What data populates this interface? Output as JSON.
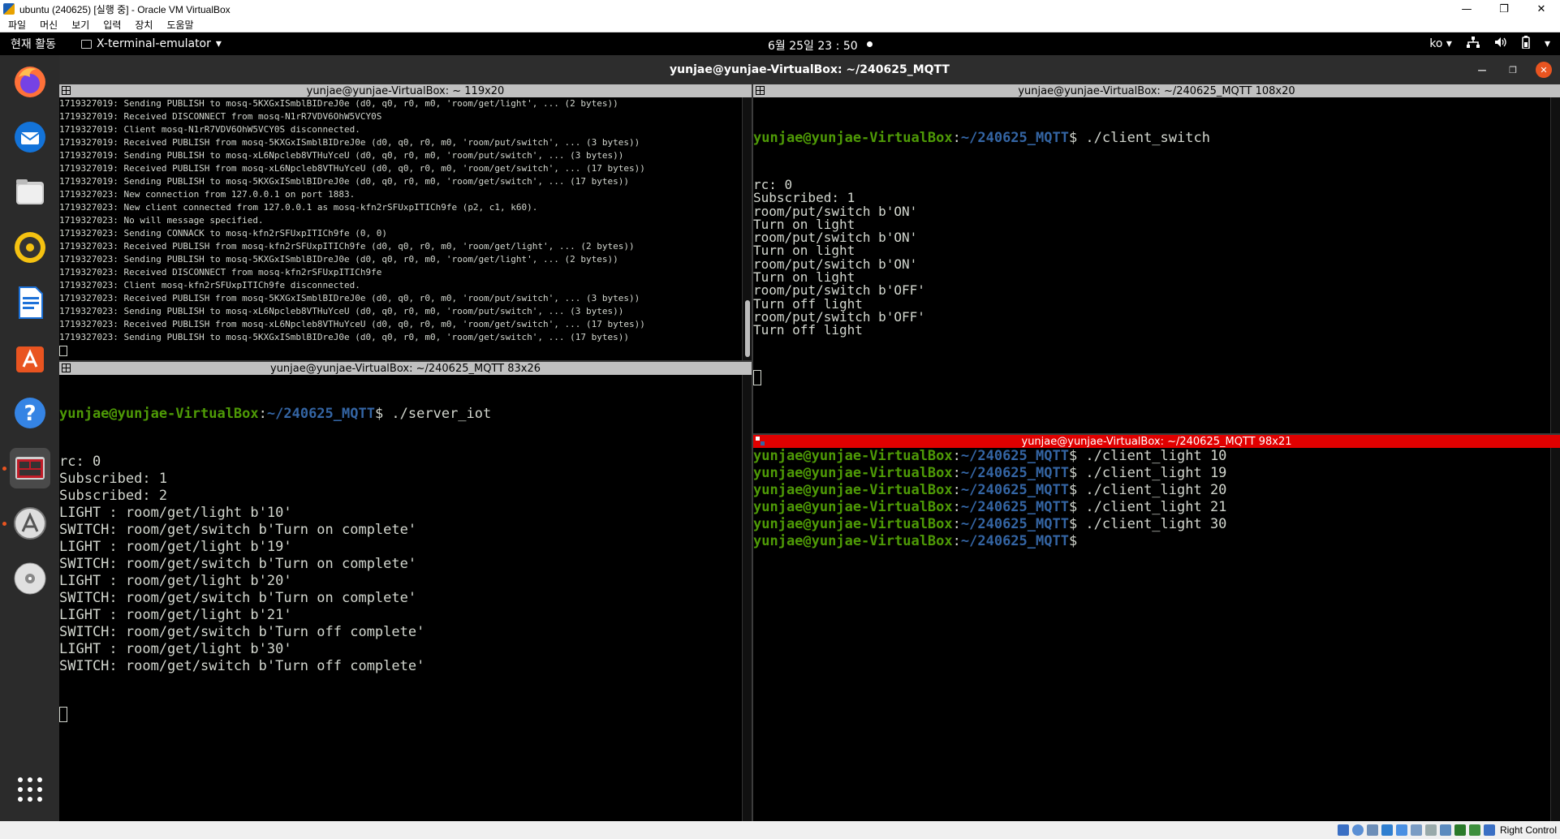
{
  "vbox": {
    "title": "ubuntu (240625) [실행 중] - Oracle VM VirtualBox",
    "menu": [
      "파일",
      "머신",
      "보기",
      "입력",
      "장치",
      "도움말"
    ],
    "minimize": "—",
    "maximize": "❐",
    "close": "✕",
    "host_key": "Right Control"
  },
  "topbar": {
    "activities": "현재 활동",
    "app_name": "X-terminal-emulator",
    "clock": "6월 25일  23 : 50",
    "lang": "ko"
  },
  "dock": {
    "items": [
      "firefox-icon",
      "thunderbird-icon",
      "files-icon",
      "rhythmbox-icon",
      "libreoffice-writer-icon",
      "app-center-icon",
      "help-icon",
      "terminal-icon",
      "software-updater-icon",
      "disc-icon",
      "show-apps-icon"
    ]
  },
  "terminator": {
    "window_title": "yunjae@yunjae-VirtualBox: ~/240625_MQTT",
    "panes": {
      "top_left": {
        "title": "yunjae@yunjae-VirtualBox: ~ 119x20",
        "lines": [
          "1719327019: Sending PUBLISH to mosq-5KXGxISmblBIDreJ0e (d0, q0, r0, m0, 'room/get/light', ... (2 bytes))",
          "1719327019: Received DISCONNECT from mosq-N1rR7VDV6OhW5VCY0S",
          "1719327019: Client mosq-N1rR7VDV6OhW5VCY0S disconnected.",
          "1719327019: Received PUBLISH from mosq-5KXGxISmblBIDreJ0e (d0, q0, r0, m0, 'room/put/switch', ... (3 bytes))",
          "1719327019: Sending PUBLISH to mosq-xL6Npcleb8VTHuYceU (d0, q0, r0, m0, 'room/put/switch', ... (3 bytes))",
          "1719327019: Received PUBLISH from mosq-xL6Npcleb8VTHuYceU (d0, q0, r0, m0, 'room/get/switch', ... (17 bytes))",
          "1719327019: Sending PUBLISH to mosq-5KXGxISmblBIDreJ0e (d0, q0, r0, m0, 'room/get/switch', ... (17 bytes))",
          "1719327023: New connection from 127.0.0.1 on port 1883.",
          "1719327023: New client connected from 127.0.0.1 as mosq-kfn2rSFUxpITICh9fe (p2, c1, k60).",
          "1719327023: No will message specified.",
          "1719327023: Sending CONNACK to mosq-kfn2rSFUxpITICh9fe (0, 0)",
          "1719327023: Received PUBLISH from mosq-kfn2rSFUxpITICh9fe (d0, q0, r0, m0, 'room/get/light', ... (2 bytes))",
          "1719327023: Sending PUBLISH to mosq-5KXGxISmblBIDreJ0e (d0, q0, r0, m0, 'room/get/light', ... (2 bytes))",
          "1719327023: Received DISCONNECT from mosq-kfn2rSFUxpITICh9fe",
          "1719327023: Client mosq-kfn2rSFUxpITICh9fe disconnected.",
          "1719327023: Received PUBLISH from mosq-5KXGxISmblBIDreJ0e (d0, q0, r0, m0, 'room/put/switch', ... (3 bytes))",
          "1719327023: Sending PUBLISH to mosq-xL6Npcleb8VTHuYceU (d0, q0, r0, m0, 'room/put/switch', ... (3 bytes))",
          "1719327023: Received PUBLISH from mosq-xL6Npcleb8VTHuYceU (d0, q0, r0, m0, 'room/get/switch', ... (17 bytes))",
          "1719327023: Sending PUBLISH to mosq-5KXGxISmblBIDreJ0e (d0, q0, r0, m0, 'room/get/switch', ... (17 bytes))"
        ]
      },
      "bottom_left": {
        "title": "yunjae@yunjae-VirtualBox: ~/240625_MQTT 83x26",
        "prompt_user": "yunjae@yunjae-VirtualBox",
        "prompt_path": "~/240625_MQTT",
        "command": "$ ./server_iot",
        "lines": [
          "rc: 0",
          "Subscribed: 1",
          "Subscribed: 2",
          "LIGHT : room/get/light b'10'",
          "SWITCH: room/get/switch b'Turn on complete'",
          "LIGHT : room/get/light b'19'",
          "SWITCH: room/get/switch b'Turn on complete'",
          "LIGHT : room/get/light b'20'",
          "SWITCH: room/get/switch b'Turn on complete'",
          "LIGHT : room/get/light b'21'",
          "SWITCH: room/get/switch b'Turn off complete'",
          "LIGHT : room/get/light b'30'",
          "SWITCH: room/get/switch b'Turn off complete'"
        ]
      },
      "top_right": {
        "title": "yunjae@yunjae-VirtualBox: ~/240625_MQTT 108x20",
        "prompt_user": "yunjae@yunjae-VirtualBox",
        "prompt_path": "~/240625_MQTT",
        "command": "$ ./client_switch",
        "lines": [
          "rc: 0",
          "Subscribed: 1",
          "room/put/switch b'ON'",
          "Turn on light",
          "room/put/switch b'ON'",
          "Turn on light",
          "room/put/switch b'ON'",
          "Turn on light",
          "room/put/switch b'OFF'",
          "Turn off light",
          "room/put/switch b'OFF'",
          "Turn off light"
        ]
      },
      "bottom_right": {
        "title": "yunjae@yunjae-VirtualBox: ~/240625_MQTT 98x21",
        "prompt_user": "yunjae@yunjae-VirtualBox",
        "prompt_path": "~/240625_MQTT",
        "commands": [
          "$ ./client_light 10",
          "$ ./client_light 19",
          "$ ./client_light 20",
          "$ ./client_light 21",
          "$ ./client_light 30",
          "$"
        ]
      }
    }
  }
}
